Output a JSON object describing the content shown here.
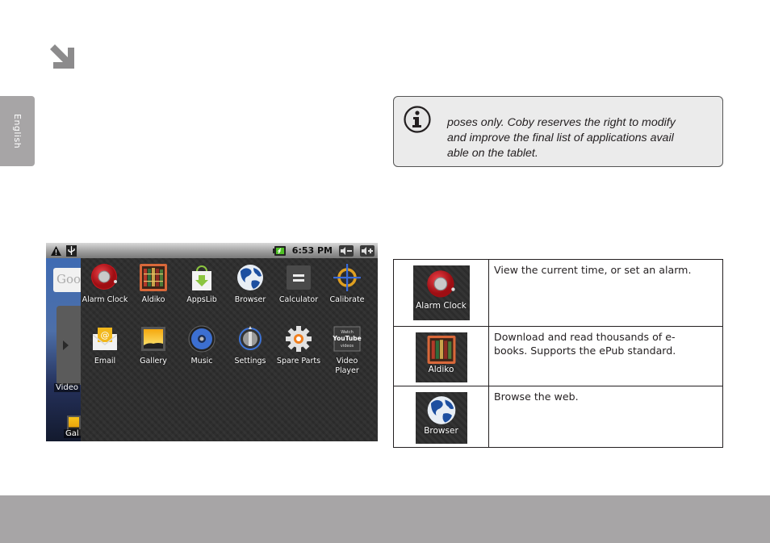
{
  "side_tab": {
    "label": "English"
  },
  "note": {
    "icon": "info-icon",
    "lines": [
      "poses only. Coby reserves the right to modify",
      "and improve the final list of applications avail",
      "able on the tablet."
    ]
  },
  "tablet_screenshot": {
    "status_bar": {
      "left_icons": [
        "warning-icon",
        "usb-icon"
      ],
      "battery_icon": "battery-charging-icon",
      "time": "6:53 PM",
      "right_buttons": [
        "volume-down-icon",
        "volume-up-icon"
      ]
    },
    "home_strip": {
      "widget_text": "Goo",
      "labels": [
        "Video",
        "Gal"
      ]
    },
    "apps": [
      {
        "label": "Alarm Clock",
        "icon": "alarm-clock-icon"
      },
      {
        "label": "Aldiko",
        "icon": "aldiko-books-icon"
      },
      {
        "label": "AppsLib",
        "icon": "appslib-bag-icon"
      },
      {
        "label": "Browser",
        "icon": "globe-icon"
      },
      {
        "label": "Calculator",
        "icon": "calculator-icon"
      },
      {
        "label": "Calibrate",
        "icon": "crosshair-icon"
      },
      {
        "label": "Email",
        "icon": "email-envelope-icon"
      },
      {
        "label": "Gallery",
        "icon": "gallery-picture-icon"
      },
      {
        "label": "Music",
        "icon": "music-speaker-icon"
      },
      {
        "label": "Settings",
        "icon": "settings-knob-icon"
      },
      {
        "label": "Spare Parts",
        "icon": "gear-icon"
      },
      {
        "label": "Video\nPlayer",
        "label_line1": "Video",
        "label_line2": "Player",
        "icon": "youtube-icon",
        "icon_text": [
          "Watch",
          "YouTube",
          "videos"
        ]
      }
    ]
  },
  "app_table": {
    "rows": [
      {
        "icon_label": "Alarm Clock",
        "icon": "alarm-clock-icon",
        "description": "View the current time, or set an alarm."
      },
      {
        "icon_label": "Aldiko",
        "icon": "aldiko-books-icon",
        "description": "Download and read thousands of e-books. Supports the ePub standard.",
        "description_lines": [
          "Download and read thousands of e-",
          "books. Supports the ePub standard."
        ]
      },
      {
        "icon_label": "Browser",
        "icon": "globe-icon",
        "description": "Browse the web."
      }
    ]
  },
  "colors": {
    "accent_gray": "#a7a5a6",
    "text": "#231f20",
    "note_bg": "#ebebeb"
  }
}
